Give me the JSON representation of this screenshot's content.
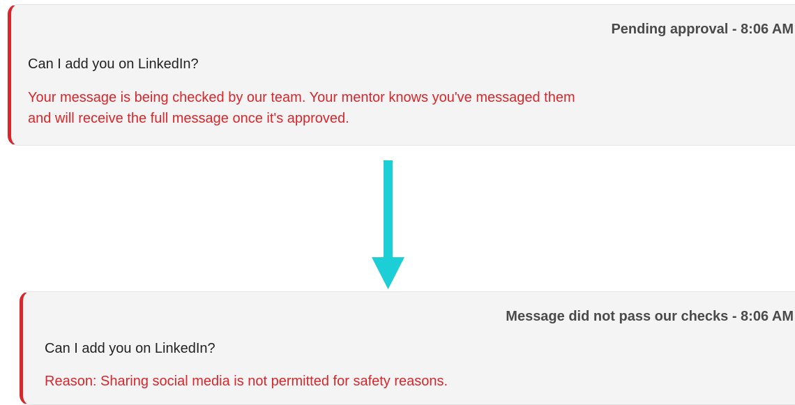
{
  "pending_card": {
    "status": "Pending approval - 8:06 AM",
    "message": "Can I add you on LinkedIn?",
    "notice_line1": "Your message is being checked by our team. Your mentor knows you've messaged them",
    "notice_line2": "and will receive the full message once it's approved."
  },
  "transition_arrow": {
    "icon": "arrow-down-icon",
    "color": "#1ccfd6"
  },
  "rejected_card": {
    "status": "Message did not pass our checks - 8:06 AM",
    "message": "Can I add you on LinkedIn?",
    "reason": "Reason: Sharing social media is not permitted for safety reasons."
  },
  "colors": {
    "accent_red": "#d9262b",
    "card_background": "#f4f4f4",
    "status_text": "#4a4a4a"
  }
}
